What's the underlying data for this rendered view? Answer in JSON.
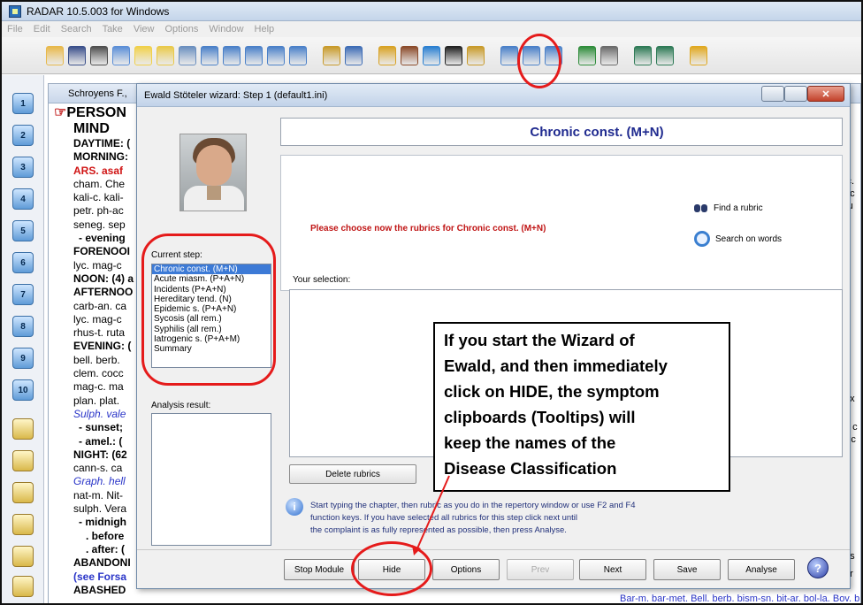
{
  "app": {
    "title": "RADAR 10.5.003 for Windows",
    "menu": [
      "File",
      "Edit",
      "Search",
      "Take",
      "View",
      "Options",
      "Window",
      "Help"
    ]
  },
  "toolbar_icons": [
    "open-book-icon",
    "binoculars-icon",
    "glasses-icon",
    "magnifier-icon",
    "bulb-icon",
    "bulb-question-icon",
    "wand-icon",
    "clipboard-icon",
    "clipboard-add-icon",
    "clipboard-copy-icon",
    "clipboard-paste-icon",
    "clipboard-remove-icon",
    "chart-icon",
    "tree-icon",
    "flask-icon",
    "hat-icon",
    "lifebuoy-icon",
    "number-25-icon",
    "wizard-icon",
    "book-export-icon",
    "card-icon",
    "frame-icon",
    "globe-icon",
    "printer-icon",
    "car-left-icon",
    "car-right-icon",
    "help-icon"
  ],
  "rail": {
    "buttons": [
      "1",
      "2",
      "3",
      "4",
      "5",
      "6",
      "7",
      "8",
      "9",
      "10"
    ]
  },
  "repertory": {
    "window_title": "Schroyens F., ",
    "heading_person": "PERSON",
    "heading_mind": "MIND",
    "lines": [
      {
        "t": "DAYTIME: (",
        "c": "rb"
      },
      {
        "t": "MORNING:",
        "c": "rb"
      },
      {
        "t": "ARS. asaf",
        "c": "red"
      },
      {
        "t": "cham. Che",
        "c": ""
      },
      {
        "t": "kali-c. kali-",
        "c": ""
      },
      {
        "t": "petr. ph-ac",
        "c": ""
      },
      {
        "t": "seneg. sep",
        "c": ""
      },
      {
        "t": "- evening",
        "c": "rb"
      },
      {
        "t": "FORENOOI",
        "c": "rb"
      },
      {
        "t": "lyc. mag-c",
        "c": ""
      },
      {
        "t": "NOON: (4) a",
        "c": "rb"
      },
      {
        "t": "AFTERNOO",
        "c": "rb"
      },
      {
        "t": "carb-an. ca",
        "c": ""
      },
      {
        "t": "lyc. mag-c",
        "c": ""
      },
      {
        "t": "rhus-t. ruta",
        "c": ""
      },
      {
        "t": "EVENING: (",
        "c": "rb"
      },
      {
        "t": "bell. berb. ",
        "c": ""
      },
      {
        "t": "clem. cocc",
        "c": ""
      },
      {
        "t": "mag-c. ma",
        "c": ""
      },
      {
        "t": "plan. plat. ",
        "c": ""
      },
      {
        "t": "Sulph. vale",
        "c": "blue"
      },
      {
        "t": "- sunset;",
        "c": "rb"
      },
      {
        "t": "- amel.: (",
        "c": "rb"
      },
      {
        "t": "NIGHT: (62",
        "c": "rb"
      },
      {
        "t": "cann-s. ca",
        "c": ""
      },
      {
        "t": "Graph. hell",
        "c": "blue"
      },
      {
        "t": "nat-m. Nit-",
        "c": ""
      },
      {
        "t": "sulph. Vera",
        "c": ""
      },
      {
        "t": "- midnigh",
        "c": "rb"
      },
      {
        "t": ". before",
        "c": "rb"
      },
      {
        "t": ". after: (",
        "c": "rb"
      },
      {
        "t": "ABANDONI",
        "c": "rb"
      },
      {
        "t": "(see Forsa",
        "c": "link"
      },
      {
        "t": "ABASHED",
        "c": "rb"
      }
    ],
    "right_fragments": [
      "ic.",
      "ec",
      "ru",
      "ux",
      "I, c",
      "Sc",
      "es",
      "ar"
    ],
    "bottom_line": "Bar-m. bar-met. Bell. berb. bism-sn. bit-ar. bol-la. Bov. br"
  },
  "wizard": {
    "title": "Ewald Stöteler wizard: Step 1  (default1.ini)",
    "header": "Chronic const. (M+N)",
    "prompt": "Please choose now the rubrics for Chronic const. (M+N)",
    "find_rubric": "Find a rubric",
    "search_words": "Search on words",
    "current_step_label": "Current step:",
    "steps": [
      "Chronic const. (M+N)",
      "Acute miasm. (P+A+N)",
      "Incidents (P+A+N)",
      "Hereditary tend. (N)",
      "Epidemic s. (P+A+N)",
      "Sycosis (all rem.)",
      "Syphilis (all rem.)",
      "Iatrogenic s. (P+A+M)",
      "Summary"
    ],
    "selected_step": 0,
    "analysis_label": "Analysis result:",
    "selection_label": "Your selection:",
    "delete_button": "Delete rubrics",
    "info_lines": [
      "Start typing the chapter, then rubric as you do in the repertory window or use F2 and F4",
      "function keys. If you have selected all rubrics for this step click next until",
      "the complaint is as fully represented as possible, then press Analyse."
    ],
    "buttons": {
      "stop": "Stop Module",
      "hide": "Hide",
      "options": "Options",
      "prev": "Prev",
      "next": "Next",
      "save": "Save",
      "analyse": "Analyse",
      "help": "?"
    }
  },
  "callout": {
    "lines": [
      "If you start the Wizard of",
      "Ewald, and then immediately",
      "click on HIDE, the symptom",
      "clipboards (Tooltips)  will",
      "keep the names of the",
      "Disease Classification"
    ]
  },
  "colors": {
    "annotation": "#e51b1b",
    "header_text": "#1f2a8f",
    "prompt_text": "#c01515",
    "list_selection": "#3c7ad6"
  }
}
